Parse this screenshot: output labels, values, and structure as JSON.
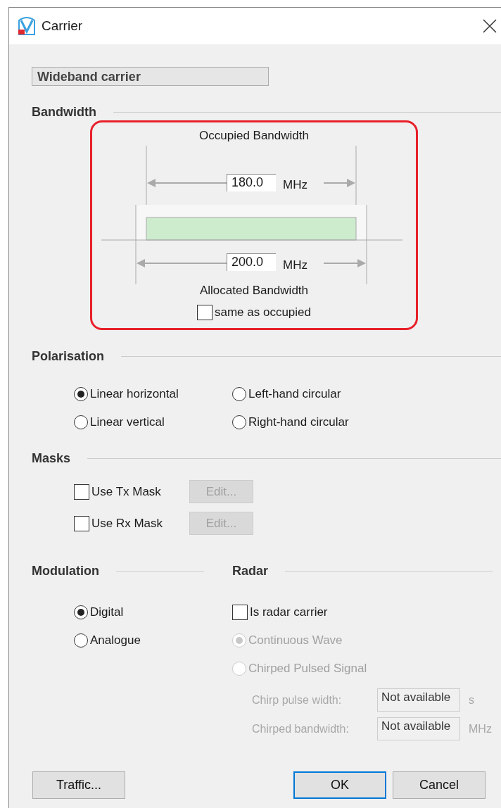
{
  "window": {
    "title": "Carrier"
  },
  "carrier_name": {
    "value": "Wideband carrier",
    "disabled": true
  },
  "bandwidth": {
    "heading": "Bandwidth",
    "highlighted": true,
    "occupied_label": "Occupied Bandwidth",
    "occupied_value": "180.0",
    "occupied_unit": "MHz",
    "allocated_value": "200.0",
    "allocated_unit": "MHz",
    "allocated_label": "Allocated Bandwidth",
    "same_as_occupied": {
      "label": "same as occupied",
      "checked": false
    }
  },
  "polarisation": {
    "heading": "Polarisation",
    "options": [
      {
        "label": "Linear horizontal",
        "selected": true
      },
      {
        "label": "Left-hand circular",
        "selected": false
      },
      {
        "label": "Linear vertical",
        "selected": false
      },
      {
        "label": "Right-hand circular",
        "selected": false
      }
    ]
  },
  "masks": {
    "heading": "Masks",
    "rows": [
      {
        "label": "Use Tx Mask",
        "checked": false,
        "button": "Edit...",
        "button_disabled": true
      },
      {
        "label": "Use Rx Mask",
        "checked": false,
        "button": "Edit...",
        "button_disabled": true
      }
    ]
  },
  "modulation": {
    "heading": "Modulation",
    "options": [
      {
        "label": "Digital",
        "selected": true
      },
      {
        "label": "Analogue",
        "selected": false
      }
    ]
  },
  "radar": {
    "heading": "Radar",
    "is_radar": {
      "label": "Is radar carrier",
      "checked": false
    },
    "options": [
      {
        "label": "Continuous Wave",
        "selected": true,
        "disabled": true
      },
      {
        "label": "Chirped Pulsed Signal",
        "selected": false,
        "disabled": true
      }
    ],
    "fields": [
      {
        "label": "Chirp pulse width:",
        "value": "Not available",
        "unit": "s",
        "disabled": true
      },
      {
        "label": "Chirped bandwidth:",
        "value": "Not available",
        "unit": "MHz",
        "disabled": true
      }
    ]
  },
  "buttons_left": [
    {
      "label": "Traffic...",
      "default": false
    }
  ],
  "buttons_right": [
    {
      "label": "OK",
      "default": true
    },
    {
      "label": "Cancel",
      "default": false
    }
  ]
}
